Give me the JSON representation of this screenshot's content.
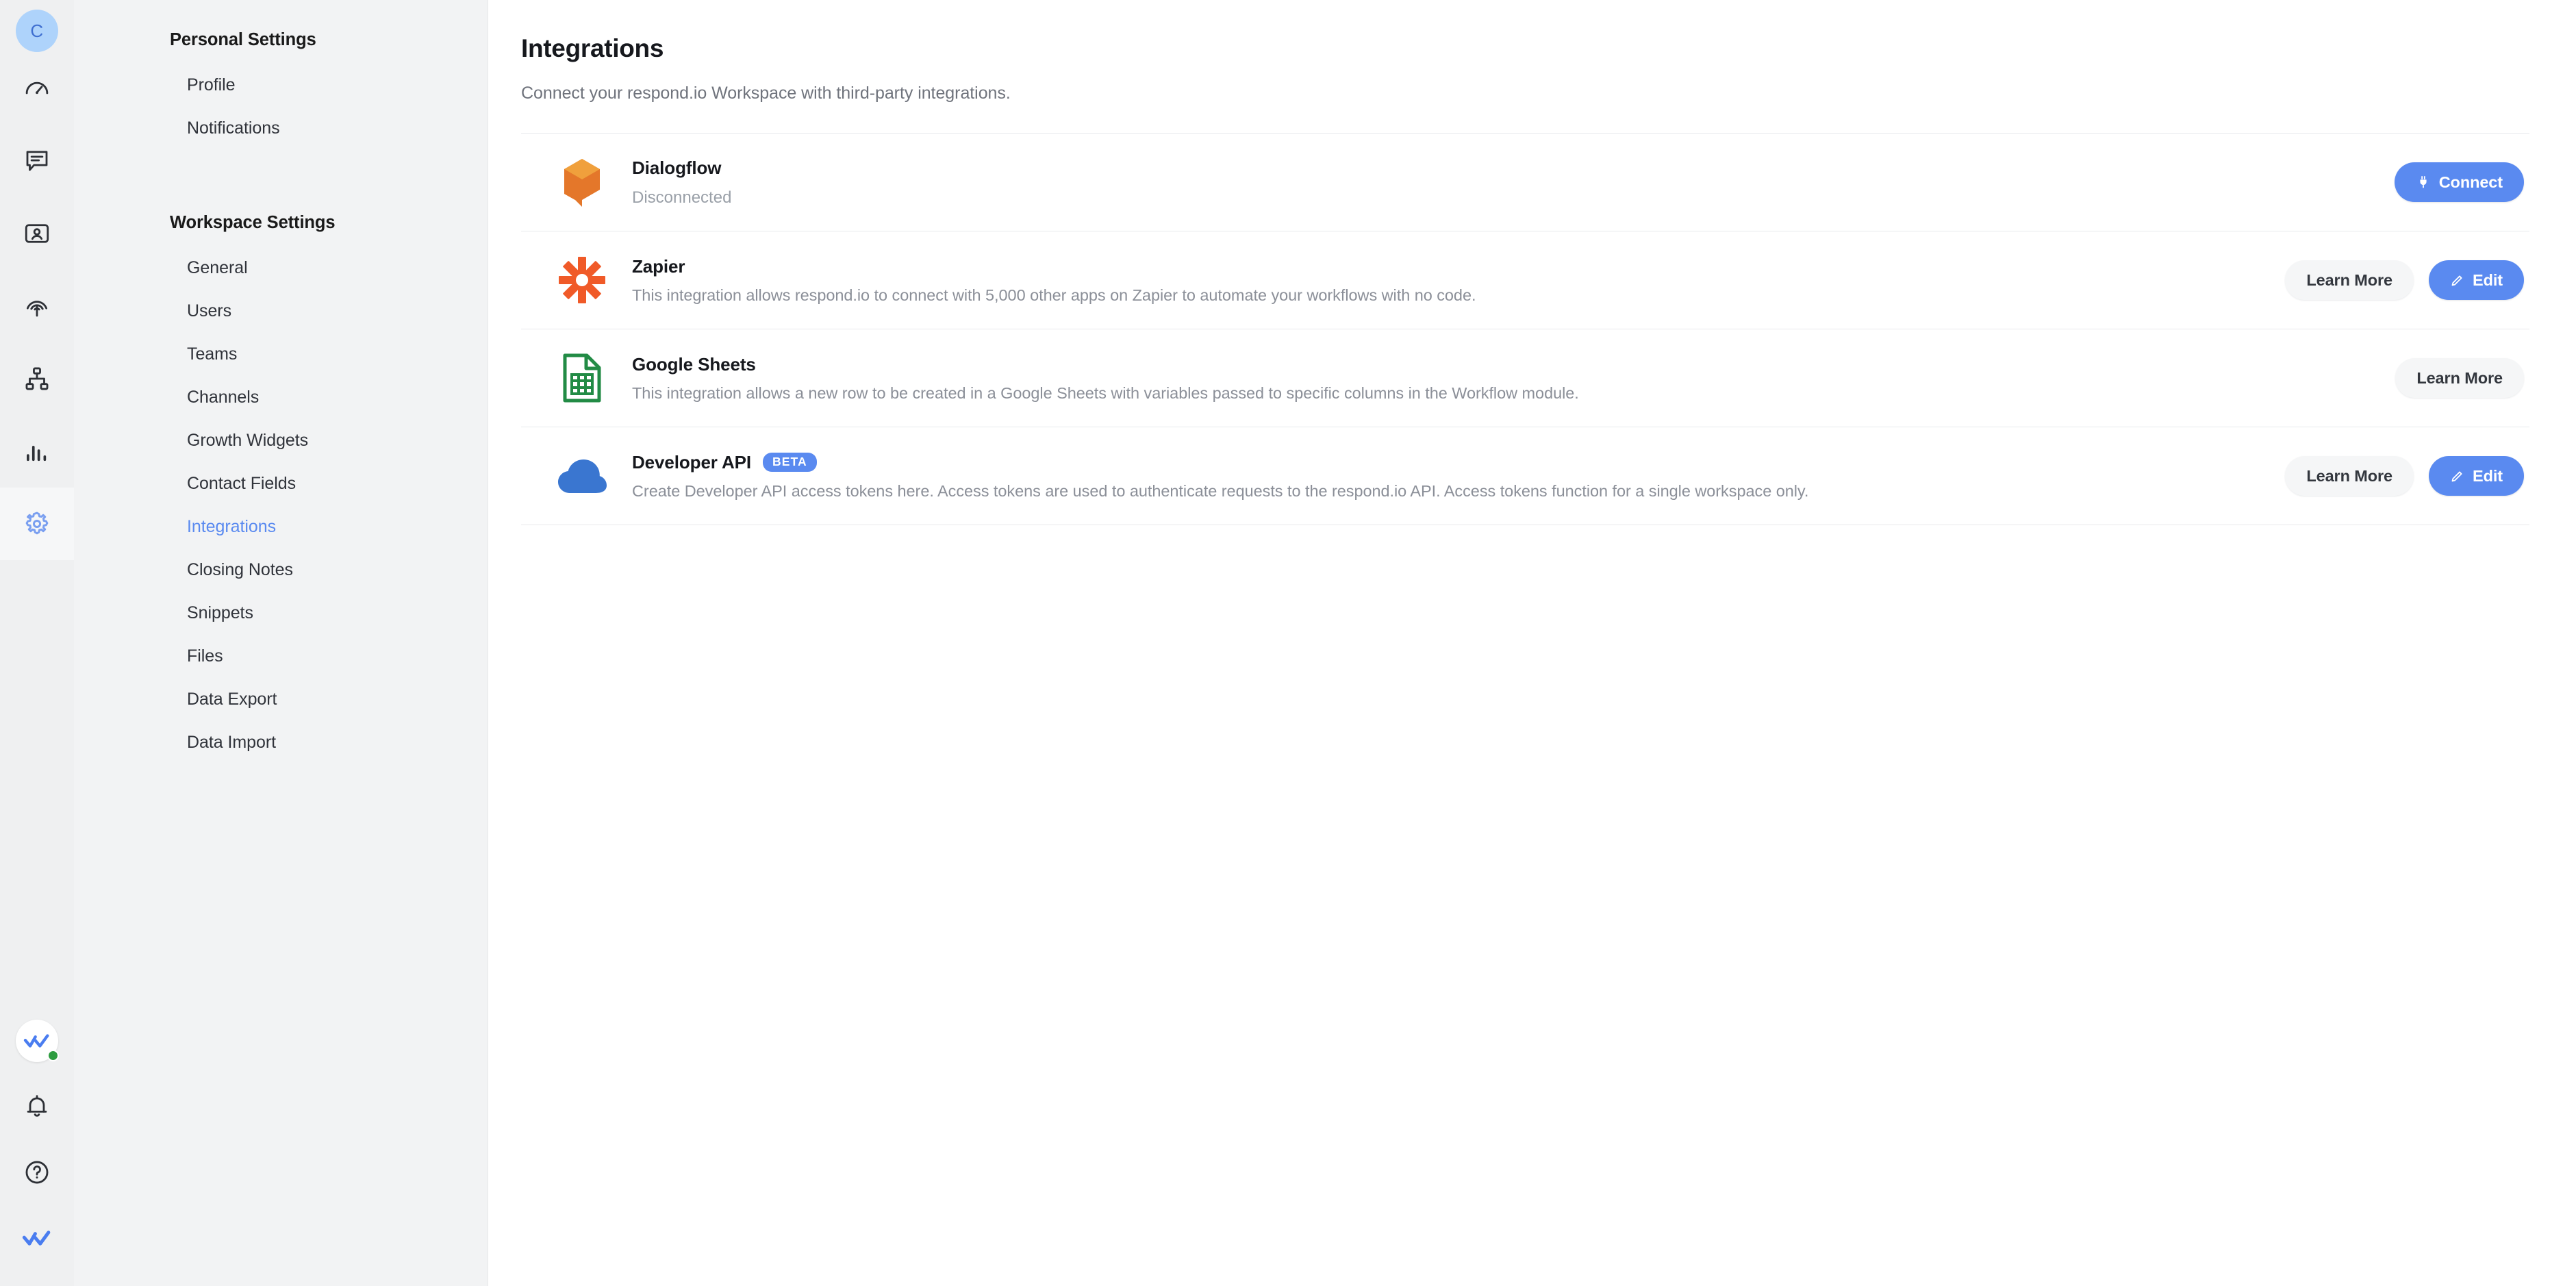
{
  "rail": {
    "avatar_initial": "C",
    "items": [
      {
        "name": "dashboard-icon",
        "label": "Dashboard"
      },
      {
        "name": "messages-icon",
        "label": "Messages"
      },
      {
        "name": "contacts-icon",
        "label": "Contacts"
      },
      {
        "name": "broadcasts-icon",
        "label": "Broadcasts"
      },
      {
        "name": "workflows-icon",
        "label": "Workflows"
      },
      {
        "name": "reports-icon",
        "label": "Reports"
      },
      {
        "name": "settings-icon",
        "label": "Settings"
      }
    ],
    "bottom_items": [
      {
        "name": "respondio-logo-icon",
        "label": "Workspace"
      },
      {
        "name": "bell-icon",
        "label": "Notifications"
      },
      {
        "name": "help-icon",
        "label": "Help"
      },
      {
        "name": "respondio-mark-icon",
        "label": "respond.io"
      }
    ]
  },
  "nav": {
    "personal_title": "Personal Settings",
    "personal_items": [
      {
        "label": "Profile",
        "active": false
      },
      {
        "label": "Notifications",
        "active": false
      }
    ],
    "workspace_title": "Workspace Settings",
    "workspace_items": [
      {
        "label": "General",
        "active": false
      },
      {
        "label": "Users",
        "active": false
      },
      {
        "label": "Teams",
        "active": false
      },
      {
        "label": "Channels",
        "active": false
      },
      {
        "label": "Growth Widgets",
        "active": false
      },
      {
        "label": "Contact Fields",
        "active": false
      },
      {
        "label": "Integrations",
        "active": true
      },
      {
        "label": "Closing Notes",
        "active": false
      },
      {
        "label": "Snippets",
        "active": false
      },
      {
        "label": "Files",
        "active": false
      },
      {
        "label": "Data Export",
        "active": false
      },
      {
        "label": "Data Import",
        "active": false
      }
    ]
  },
  "page": {
    "title": "Integrations",
    "subtitle": "Connect your respond.io Workspace with third-party integrations."
  },
  "integrations": [
    {
      "id": "dialogflow",
      "icon": "dialogflow-logo-icon",
      "name": "Dialogflow",
      "status": "Disconnected",
      "description": "",
      "badge": "",
      "buttons": [
        {
          "label": "Connect",
          "style": "primary",
          "icon": "plug-icon"
        }
      ]
    },
    {
      "id": "zapier",
      "icon": "zapier-logo-icon",
      "name": "Zapier",
      "status": "",
      "description": "This integration allows respond.io to connect with 5,000 other apps on Zapier to automate your workflows with no code.",
      "badge": "",
      "buttons": [
        {
          "label": "Learn More",
          "style": "secondary",
          "icon": ""
        },
        {
          "label": "Edit",
          "style": "primary",
          "icon": "pencil-icon"
        }
      ]
    },
    {
      "id": "google-sheets",
      "icon": "google-sheets-logo-icon",
      "name": "Google Sheets",
      "status": "",
      "description": "This integration allows a new row to be created in a Google Sheets with variables passed to specific columns in the Workflow module.",
      "badge": "",
      "buttons": [
        {
          "label": "Learn More",
          "style": "secondary",
          "icon": ""
        }
      ]
    },
    {
      "id": "developer-api",
      "icon": "cloud-logo-icon",
      "name": "Developer API",
      "status": "",
      "description": "Create Developer API access tokens here. Access tokens are used to authenticate requests to the respond.io API. Access tokens function for a single workspace only.",
      "badge": "BETA",
      "buttons": [
        {
          "label": "Learn More",
          "style": "secondary",
          "icon": ""
        },
        {
          "label": "Edit",
          "style": "primary",
          "icon": "pencil-icon"
        }
      ]
    }
  ],
  "colors": {
    "accent": "#5a8af0",
    "rail_bg": "#eff0f1",
    "nav_bg": "#f2f3f4",
    "dialogflow_orange": "#e8792b",
    "zapier_orange": "#f05a28",
    "sheets_green": "#228b45",
    "cloud_blue": "#3a76d0",
    "status_online": "#2d9c3f"
  }
}
